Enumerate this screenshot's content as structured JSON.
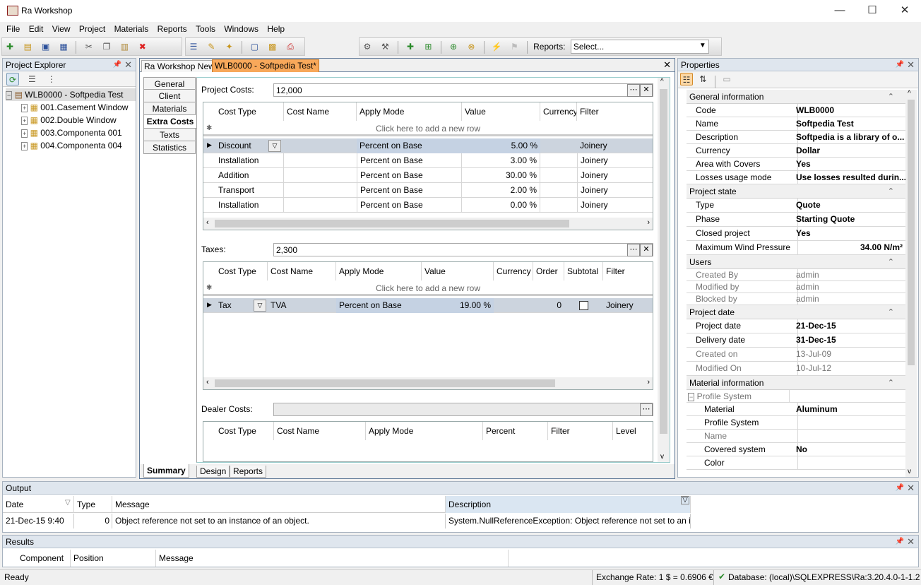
{
  "app": {
    "title": "Ra Workshop",
    "minimize": "—",
    "maximize": "☐",
    "close": "✕"
  },
  "menu": [
    "File",
    "Edit",
    "View",
    "Project",
    "Materials",
    "Reports",
    "Tools",
    "Windows",
    "Help"
  ],
  "toolbar": {
    "reports_label": "Reports:",
    "reports_select": "Select..."
  },
  "project_explorer": {
    "title": "Project Explorer",
    "root": "WLB0000 - Softpedia Test",
    "items": [
      "001.Casement Window",
      "002.Double Window",
      "003.Componenta 001",
      "004.Componenta 004"
    ]
  },
  "doc_tabs": [
    "Ra Workshop News",
    "WLB0000 - Softpedia Test*"
  ],
  "side_tabs": [
    "General",
    "Client",
    "Materials",
    "Extra Costs",
    "Texts",
    "Statistics"
  ],
  "project_costs": {
    "label": "Project Costs:",
    "value": "12,000",
    "columns": [
      "Cost Type",
      "Cost Name",
      "Apply Mode",
      "Value",
      "Currency",
      "Filter"
    ],
    "new_row": "Click here to add a new row",
    "rows": [
      {
        "type": "Discount",
        "name": "",
        "mode": "Percent on Base",
        "value": "5.00 %",
        "currency": "",
        "filter": "Joinery"
      },
      {
        "type": "Installation",
        "name": "",
        "mode": "Percent on Base",
        "value": "3.00 %",
        "currency": "",
        "filter": "Joinery"
      },
      {
        "type": "Addition",
        "name": "",
        "mode": "Percent on Base",
        "value": "30.00 %",
        "currency": "",
        "filter": "Joinery"
      },
      {
        "type": "Transport",
        "name": "",
        "mode": "Percent on Base",
        "value": "2.00 %",
        "currency": "",
        "filter": "Joinery"
      },
      {
        "type": "Installation",
        "name": "",
        "mode": "Percent on Base",
        "value": "0.00 %",
        "currency": "",
        "filter": "Joinery"
      }
    ]
  },
  "taxes": {
    "label": "Taxes:",
    "value": "2,300",
    "columns": [
      "Cost Type",
      "Cost Name",
      "Apply Mode",
      "Value",
      "Currency",
      "Order",
      "Subtotal",
      "Filter"
    ],
    "new_row": "Click here to add a new row",
    "rows": [
      {
        "type": "Tax",
        "name": "TVA",
        "mode": "Percent on Base",
        "value": "19.00 %",
        "currency": "",
        "order": "0",
        "filter": "Joinery"
      }
    ]
  },
  "dealer_costs": {
    "label": "Dealer Costs:",
    "columns": [
      "Cost Type",
      "Cost Name",
      "Apply Mode",
      "Percent",
      "Filter",
      "Level"
    ]
  },
  "bottom_tabs": [
    "Summary",
    "Design",
    "Reports"
  ],
  "properties": {
    "title": "Properties",
    "sections": [
      {
        "name": "General information",
        "rows": [
          {
            "k": "Code",
            "v": "WLB0000"
          },
          {
            "k": "Name",
            "v": "Softpedia Test"
          },
          {
            "k": "Description",
            "v": "Softpedia is a library of o..."
          },
          {
            "k": "Currency",
            "v": "Dollar"
          },
          {
            "k": "Area with Covers",
            "v": "Yes"
          },
          {
            "k": "Losses usage mode",
            "v": "Use losses resulted durin..."
          }
        ]
      },
      {
        "name": "Project state",
        "rows": [
          {
            "k": "Type",
            "v": "Quote"
          },
          {
            "k": "Phase",
            "v": "Starting Quote"
          },
          {
            "k": "Closed project",
            "v": "Yes"
          },
          {
            "k": "Maximum Wind Pressure",
            "v": "34.00 N/m²"
          }
        ]
      },
      {
        "name": "Users",
        "rows": [
          {
            "k": "Created By",
            "v": "admin",
            "dim": true
          },
          {
            "k": "Modified by",
            "v": "admin",
            "dim": true
          },
          {
            "k": "Blocked by",
            "v": "admin",
            "dim": true
          }
        ]
      },
      {
        "name": "Project date",
        "rows": [
          {
            "k": "Project date",
            "v": "21-Dec-15"
          },
          {
            "k": "Delivery date",
            "v": "31-Dec-15"
          },
          {
            "k": "Created on",
            "v": "13-Jul-09",
            "dim": true
          },
          {
            "k": "Modified On",
            "v": "10-Jul-12",
            "dim": true
          }
        ]
      },
      {
        "name": "Material information",
        "rows": [
          {
            "k": "Profile System",
            "v": "",
            "dim": true,
            "group": true
          },
          {
            "k": "Material",
            "v": "Aluminum"
          },
          {
            "k": "Profile System",
            "v": ""
          },
          {
            "k": "Name",
            "v": "",
            "dim": true
          },
          {
            "k": "Covered system",
            "v": "No"
          },
          {
            "k": "Color",
            "v": ""
          }
        ]
      }
    ]
  },
  "output": {
    "title": "Output",
    "columns": [
      "Date",
      "Type",
      "Message",
      "Description"
    ],
    "row": {
      "date": "21-Dec-15 9:40",
      "type": "0",
      "message": "Object reference not set to an instance of an object.",
      "description": "System.NullReferenceException: Object reference not set to an inst..."
    }
  },
  "results": {
    "title": "Results",
    "columns": [
      "Component",
      "Position",
      "Message"
    ]
  },
  "status": {
    "left": "Ready",
    "exchange": "Exchange Rate: 1 $ = 0.6906 €",
    "database": "Database: (local)\\SQLEXPRESS\\Ra:3.20.4.0-1-1.2"
  }
}
